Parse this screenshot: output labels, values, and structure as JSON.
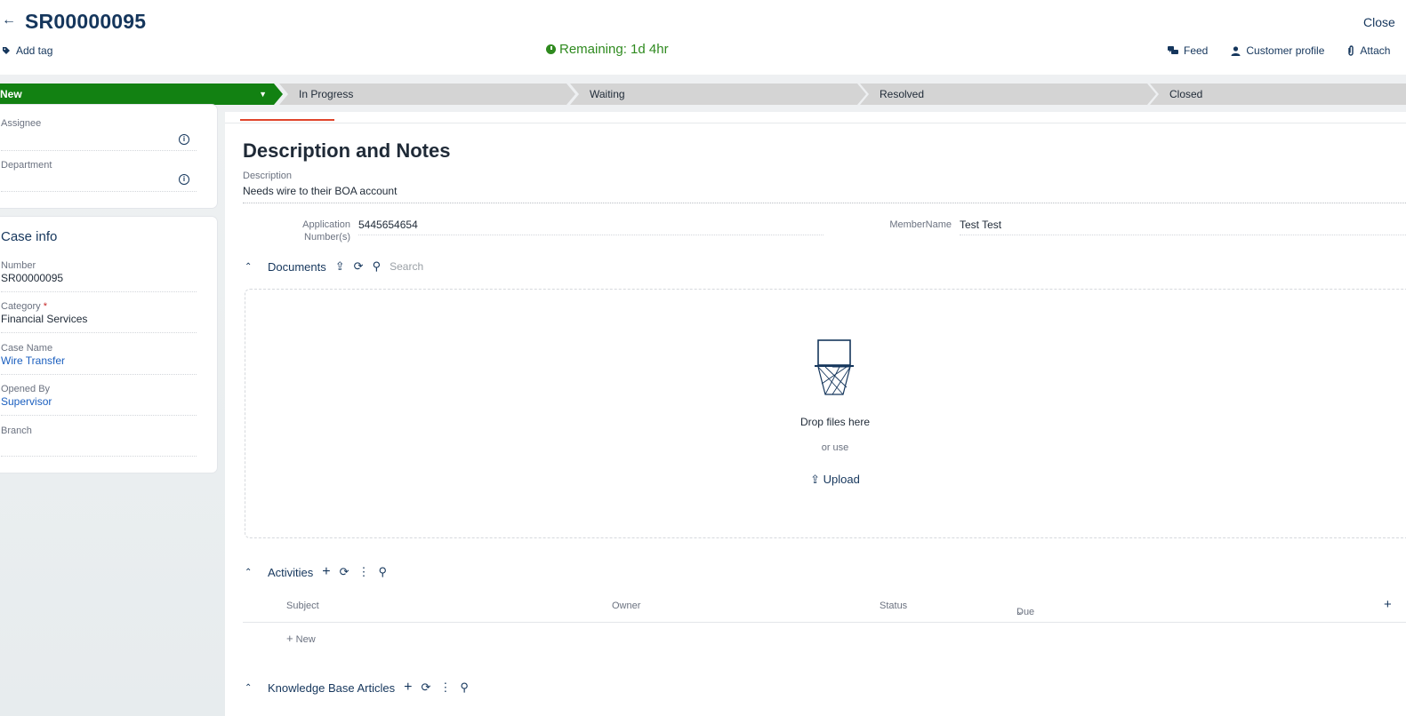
{
  "header": {
    "title": "SR00000095",
    "close_label": "Close",
    "add_tag_label": "Add tag",
    "remaining_label": "Remaining: 1d 4hr",
    "actions": [
      {
        "label": "Feed",
        "icon": "feed-icon"
      },
      {
        "label": "Customer profile",
        "icon": "person-icon"
      },
      {
        "label": "Attach",
        "icon": "paperclip-icon"
      }
    ]
  },
  "stages": [
    {
      "label": "New",
      "active": true
    },
    {
      "label": "In Progress",
      "active": false
    },
    {
      "label": "Waiting",
      "active": false
    },
    {
      "label": "Resolved",
      "active": false
    },
    {
      "label": "Closed",
      "active": false
    }
  ],
  "sidebar": {
    "assignee_label": "Assignee",
    "assignee_value": "",
    "department_label": "Department",
    "department_value": "",
    "case_info_title": "Case info",
    "number_label": "Number",
    "number_value": "SR00000095",
    "category_label": "Category",
    "category_required": "*",
    "category_value": "Financial Services",
    "case_name_label": "Case Name",
    "case_name_value": "Wire Transfer",
    "opened_by_label": "Opened By",
    "opened_by_value": "Supervisor",
    "branch_label": "Branch",
    "branch_value": ""
  },
  "main": {
    "section_title": "Description and Notes",
    "description_label": "Description",
    "description_value": "Needs wire to their BOA account",
    "application_label": "Application Number(s)",
    "application_value": "5445654654",
    "member_label": "MemberName",
    "member_value": "Test Test",
    "documents_title": "Documents",
    "documents_search_placeholder": "Search",
    "drop_title": "Drop files here",
    "drop_or": "or use",
    "upload_label": "Upload",
    "activities_title": "Activities",
    "grid_columns": [
      "Subject",
      "Owner",
      "Status",
      "Due"
    ],
    "grid_new_label": "New",
    "kb_title": "Knowledge Base Articles"
  },
  "colors": {
    "brand": "#15365c",
    "active_stage": "#128112",
    "remaining": "#2f8a1f",
    "link": "#1b5fbf"
  }
}
